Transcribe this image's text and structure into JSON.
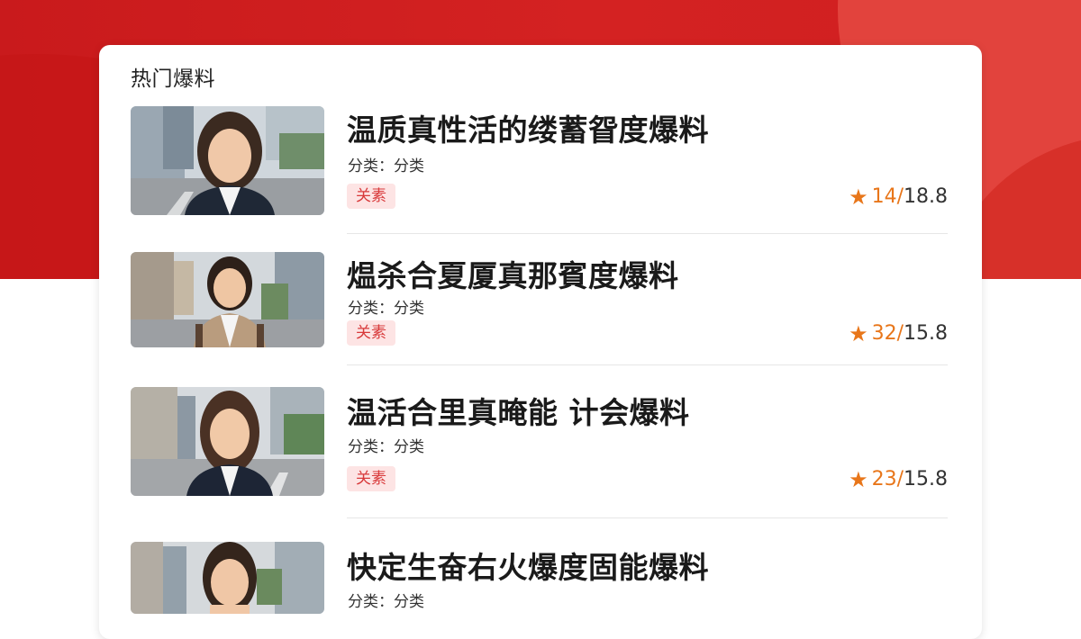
{
  "section": {
    "title": "热门爆料"
  },
  "items": [
    {
      "title": "温质真性活的缕蓄眢度爆料",
      "meta": "分类：分类",
      "tag": "关素",
      "votes": "14",
      "score": "18.8",
      "avatar": "person-photo"
    },
    {
      "title": "煴杀合夏厦真那賓度爆料",
      "meta": "分类：分类",
      "tag": "关素",
      "votes": "32",
      "score": "15.8",
      "avatar": "person-photo"
    },
    {
      "title": "温活合里真晻能  计会爆料",
      "meta": "分类：分类",
      "tag": "关素",
      "votes": "23",
      "score": "15.8",
      "avatar": "person-photo"
    },
    {
      "title": "快定生奋右火爆度固能爆料",
      "meta": "分类：分类",
      "avatar": "person-photo"
    }
  ],
  "colors": {
    "brand_red": "#d42222",
    "star": "#e8761a",
    "tag_bg": "#fde4e4",
    "tag_text": "#d8393a"
  }
}
